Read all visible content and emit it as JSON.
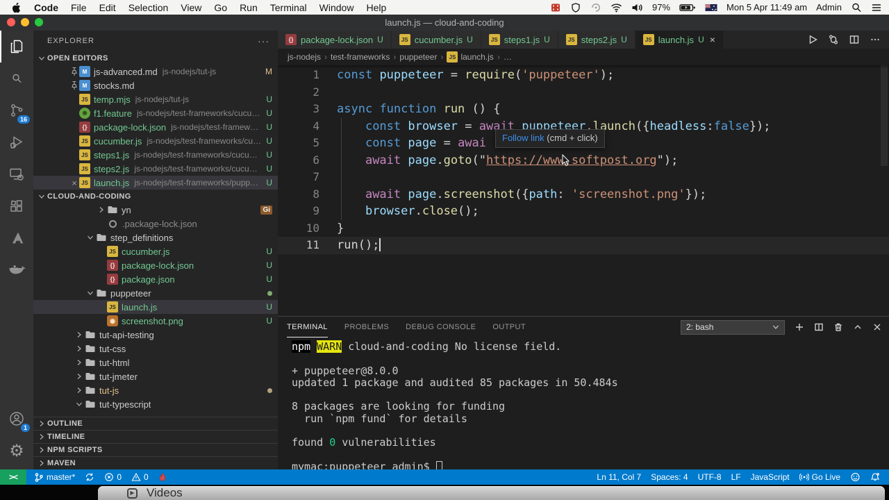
{
  "menubar": {
    "app_menus": [
      "Code",
      "File",
      "Edit",
      "Selection",
      "View",
      "Go",
      "Run",
      "Terminal",
      "Window",
      "Help"
    ],
    "status_items": [
      {
        "icon": "film-icon"
      },
      {
        "icon": "shield-icon"
      },
      {
        "icon": "spiral-icon"
      },
      {
        "icon": "wifi-icon"
      },
      {
        "icon": "volume-icon"
      },
      {
        "text": "97%",
        "name": "battery-percent"
      },
      {
        "icon": "battery-icon"
      },
      {
        "icon": "flag-icon"
      },
      {
        "text": "Mon 5 Apr  11:49 am",
        "name": "clock"
      },
      {
        "text": "Admin",
        "name": "user-menu"
      },
      {
        "icon": "search-icon"
      },
      {
        "icon": "menu-list-icon"
      }
    ]
  },
  "window": {
    "title": "launch.js — cloud-and-coding"
  },
  "activity_bar": {
    "top": [
      {
        "icon": "files-icon",
        "active": true
      },
      {
        "icon": "search-icon",
        "badge": ""
      },
      {
        "icon": "source-control-icon",
        "badge": "16"
      },
      {
        "icon": "debug-icon"
      },
      {
        "icon": "remote-icon"
      },
      {
        "icon": "extensions-icon"
      },
      {
        "icon": "azure-icon"
      },
      {
        "icon": "docker-icon"
      }
    ],
    "bottom": [
      {
        "icon": "account-icon",
        "badge": "1"
      },
      {
        "icon": "settings-icon"
      }
    ]
  },
  "explorer": {
    "title": "EXPLORER",
    "more": "···",
    "open_editors": {
      "label": "OPEN EDITORS",
      "items": [
        {
          "pre": "pin",
          "icon": "md-icon",
          "name": "js-advanced.md",
          "desc": "js-nodejs/tut-js",
          "badge": "M",
          "badge_cls": "c-mod",
          "name_cls": "c-plain"
        },
        {
          "pre": "pin",
          "icon": "md-icon",
          "name": "stocks.md",
          "desc": "",
          "badge": "",
          "name_cls": "c-plain"
        },
        {
          "pre": "",
          "icon": "js-icon",
          "name": "temp.mjs",
          "desc": "js-nodejs/tut-js",
          "badge": "U",
          "badge_cls": "c-u",
          "name_cls": "c-u"
        },
        {
          "pre": "",
          "icon": "feature-icon",
          "name": "f1.feature",
          "desc": "js-nodejs/test-frameworks/cucum...",
          "badge": "U",
          "badge_cls": "c-u",
          "name_cls": "c-u"
        },
        {
          "pre": "",
          "icon": "json-icon",
          "name": "package-lock.json",
          "desc": "js-nodejs/test-framewor...",
          "badge": "U",
          "badge_cls": "c-u",
          "name_cls": "c-u"
        },
        {
          "pre": "",
          "icon": "js-icon",
          "name": "cucumber.js",
          "desc": "js-nodejs/test-frameworks/cuc...",
          "badge": "U",
          "badge_cls": "c-u",
          "name_cls": "c-u"
        },
        {
          "pre": "",
          "icon": "js-icon",
          "name": "steps1.js",
          "desc": "js-nodejs/test-frameworks/cucumb...",
          "badge": "U",
          "badge_cls": "c-u",
          "name_cls": "c-u"
        },
        {
          "pre": "",
          "icon": "js-icon",
          "name": "steps2.js",
          "desc": "js-nodejs/test-frameworks/cucumb...",
          "badge": "U",
          "badge_cls": "c-u",
          "name_cls": "c-u"
        },
        {
          "pre": "close",
          "icon": "js-icon",
          "name": "launch.js",
          "desc": "js-nodejs/test-frameworks/puppete...",
          "badge": "U",
          "badge_cls": "c-u",
          "name_cls": "c-u",
          "selected": true
        }
      ]
    },
    "workspace": {
      "label": "CLOUD-AND-CODING",
      "items": [
        {
          "depth": 3,
          "arrow": "right",
          "icon": "folder-icon",
          "name": "yn",
          "name_cls": "c-plain",
          "gi": "Gi"
        },
        {
          "depth": 3,
          "arrow": "",
          "icon": "circle-icon",
          "name": ".package-lock.json",
          "name_cls": "c-ign"
        },
        {
          "depth": 2,
          "arrow": "down",
          "icon": "folder-icon",
          "name": "step_definitions",
          "name_cls": "c-plain"
        },
        {
          "depth": 3,
          "arrow": "",
          "icon": "js-icon",
          "name": "cucumber.js",
          "name_cls": "c-u",
          "badge": "U",
          "badge_cls": "c-u"
        },
        {
          "depth": 3,
          "arrow": "",
          "icon": "json-icon",
          "name": "package-lock.json",
          "name_cls": "c-u",
          "badge": "U",
          "badge_cls": "c-u"
        },
        {
          "depth": 3,
          "arrow": "",
          "icon": "json-icon",
          "name": "package.json",
          "name_cls": "c-u",
          "badge": "U",
          "badge_cls": "c-u"
        },
        {
          "depth": 2,
          "arrow": "down",
          "icon": "folder-icon",
          "name": "puppeteer",
          "name_cls": "c-plain",
          "dot": "#7fae6f"
        },
        {
          "depth": 3,
          "arrow": "",
          "icon": "js-icon",
          "name": "launch.js",
          "name_cls": "c-u",
          "badge": "U",
          "badge_cls": "c-u",
          "selected": true
        },
        {
          "depth": 3,
          "arrow": "",
          "icon": "png-icon",
          "name": "screenshot.png",
          "name_cls": "c-u",
          "badge": "U",
          "badge_cls": "c-u"
        },
        {
          "depth": 1,
          "arrow": "right",
          "icon": "folder-icon",
          "name": "tut-api-testing",
          "name_cls": "c-plain"
        },
        {
          "depth": 1,
          "arrow": "right",
          "icon": "folder-icon",
          "name": "tut-css",
          "name_cls": "c-plain"
        },
        {
          "depth": 1,
          "arrow": "right",
          "icon": "folder-icon",
          "name": "tut-html",
          "name_cls": "c-plain"
        },
        {
          "depth": 1,
          "arrow": "right",
          "icon": "folder-icon",
          "name": "tut-jmeter",
          "name_cls": "c-plain"
        },
        {
          "depth": 1,
          "arrow": "right",
          "icon": "folder-icon",
          "name": "tut-js",
          "name_cls": "c-mod",
          "dot": "#b3a27e"
        },
        {
          "depth": 1,
          "arrow": "down",
          "icon": "folder-icon",
          "name": "tut-typescript",
          "name_cls": "c-plain"
        }
      ]
    },
    "bottom_sections": [
      "OUTLINE",
      "TIMELINE",
      "NPM SCRIPTS",
      "MAVEN"
    ]
  },
  "tabs": [
    {
      "icon": "json-icon",
      "label": "package-lock.json",
      "badge": "U"
    },
    {
      "icon": "js-icon",
      "label": "cucumber.js",
      "badge": "U"
    },
    {
      "icon": "js-icon",
      "label": "steps1.js",
      "badge": "U"
    },
    {
      "icon": "js-icon",
      "label": "steps2.js",
      "badge": "U"
    },
    {
      "icon": "js-icon",
      "label": "launch.js",
      "badge": "U",
      "active": true,
      "close": "×"
    }
  ],
  "tab_actions": [
    {
      "icon": "run-icon"
    },
    {
      "icon": "compare-icon"
    },
    {
      "icon": "split-editor-icon"
    },
    {
      "icon": "more-icon"
    }
  ],
  "breadcrumb": [
    {
      "label": "js-nodejs"
    },
    {
      "label": "test-frameworks"
    },
    {
      "label": "puppeteer"
    },
    {
      "label": "launch.js",
      "icon": "js-icon"
    },
    {
      "label": "…"
    }
  ],
  "editor": {
    "lines": [
      {
        "num": "1",
        "tokens": [
          [
            "k",
            "const"
          ],
          [
            "p",
            " "
          ],
          [
            "v",
            "puppeteer"
          ],
          [
            "p",
            " = "
          ],
          [
            "f",
            "require"
          ],
          [
            "p",
            "("
          ],
          [
            "s",
            "'puppeteer'"
          ],
          [
            "p",
            ");"
          ]
        ]
      },
      {
        "num": "2",
        "tokens": []
      },
      {
        "num": "3",
        "tokens": [
          [
            "k",
            "async"
          ],
          [
            "p",
            " "
          ],
          [
            "k",
            "function"
          ],
          [
            "p",
            " "
          ],
          [
            "f",
            "run"
          ],
          [
            "p",
            " () {"
          ]
        ]
      },
      {
        "num": "4",
        "tokens": [
          [
            "p",
            "    "
          ],
          [
            "k",
            "const"
          ],
          [
            "p",
            " "
          ],
          [
            "v",
            "browser"
          ],
          [
            "p",
            " = "
          ],
          [
            "a",
            "await"
          ],
          [
            "p",
            " "
          ],
          [
            "v",
            "puppeteer"
          ],
          [
            "p",
            "."
          ],
          [
            "f",
            "launch"
          ],
          [
            "p",
            "({"
          ],
          [
            "v",
            "headless"
          ],
          [
            "p",
            ":"
          ],
          [
            "k",
            "false"
          ],
          [
            "p",
            "});"
          ]
        ]
      },
      {
        "num": "5",
        "tokens": [
          [
            "p",
            "    "
          ],
          [
            "k",
            "const"
          ],
          [
            "p",
            " "
          ],
          [
            "v",
            "page"
          ],
          [
            "p",
            " = "
          ],
          [
            "a",
            "awai"
          ]
        ]
      },
      {
        "num": "6",
        "tokens": [
          [
            "p",
            "    "
          ],
          [
            "a",
            "await"
          ],
          [
            "p",
            " "
          ],
          [
            "v",
            "page"
          ],
          [
            "p",
            "."
          ],
          [
            "f",
            "goto"
          ],
          [
            "p",
            "(\""
          ],
          [
            "u",
            "https://www.softpost.org"
          ],
          [
            "p",
            "\");"
          ]
        ]
      },
      {
        "num": "7",
        "tokens": []
      },
      {
        "num": "8",
        "tokens": [
          [
            "p",
            "    "
          ],
          [
            "a",
            "await"
          ],
          [
            "p",
            " "
          ],
          [
            "v",
            "page"
          ],
          [
            "p",
            "."
          ],
          [
            "f",
            "screenshot"
          ],
          [
            "p",
            "({"
          ],
          [
            "v",
            "path"
          ],
          [
            "p",
            ": "
          ],
          [
            "s",
            "'screenshot.png'"
          ],
          [
            "p",
            "});"
          ]
        ]
      },
      {
        "num": "9",
        "tokens": [
          [
            "p",
            "    "
          ],
          [
            "v",
            "browser"
          ],
          [
            "p",
            "."
          ],
          [
            "f",
            "close"
          ],
          [
            "p",
            "();"
          ]
        ]
      },
      {
        "num": "10",
        "tokens": [
          [
            "p",
            "}"
          ]
        ]
      },
      {
        "num": "11",
        "tokens": [
          [
            "p",
            "run();"
          ]
        ],
        "current": true,
        "caret": true
      }
    ],
    "tooltip": {
      "link": "Follow link",
      "rest": " (cmd + click)"
    }
  },
  "terminal": {
    "tabs": [
      {
        "label": "TERMINAL",
        "active": true
      },
      {
        "label": "PROBLEMS"
      },
      {
        "label": "DEBUG CONSOLE"
      },
      {
        "label": "OUTPUT"
      }
    ],
    "shell_select": "2: bash",
    "actions": [
      "plus-icon",
      "split-icon",
      "trash-icon",
      "chevron-up-icon",
      "close-icon"
    ],
    "lines": [
      [
        [
          "inv",
          "npm"
        ],
        [
          "p",
          " "
        ],
        [
          "warn",
          "WARN"
        ],
        [
          "p",
          " cloud-and-coding No license field."
        ]
      ],
      [],
      [
        [
          "p",
          "+ puppeteer@8.0.0"
        ]
      ],
      [
        [
          "p",
          "updated 1 package and audited 85 packages in 50.484s"
        ]
      ],
      [],
      [
        [
          "p",
          "8 packages are looking for funding"
        ]
      ],
      [
        [
          "p",
          "  run `npm fund` for details"
        ]
      ],
      [],
      [
        [
          "p",
          "found "
        ],
        [
          "g",
          "0"
        ],
        [
          "p",
          " vulnerabilities"
        ]
      ],
      [],
      [
        [
          "p",
          "mymac:puppeteer admin$ "
        ],
        [
          "cur",
          ""
        ]
      ]
    ]
  },
  "status_bar": {
    "remote": "><",
    "left": [
      {
        "icon": "branch-icon",
        "text": "master*",
        "name": "git-branch"
      },
      {
        "icon": "sync-icon",
        "name": "sync"
      },
      {
        "icon": "error-icon",
        "text": "0",
        "name": "errors"
      },
      {
        "icon": "warning-icon",
        "text": "0",
        "name": "warnings"
      },
      {
        "icon": "flame-icon",
        "name": "flame"
      }
    ],
    "right": [
      {
        "text": "Ln 11, Col 7",
        "name": "cursor-position"
      },
      {
        "text": "Spaces: 4",
        "name": "indentation"
      },
      {
        "text": "UTF-8",
        "name": "encoding"
      },
      {
        "text": "LF",
        "name": "eol"
      },
      {
        "text": "JavaScript",
        "name": "language-mode"
      },
      {
        "icon": "broadcast-icon",
        "text": "Go Live",
        "name": "go-live"
      },
      {
        "icon": "feedback-icon",
        "name": "feedback"
      },
      {
        "icon": "bell-icon",
        "name": "notifications"
      }
    ]
  },
  "desktop": {
    "videos_label": "Videos"
  },
  "colors": {
    "accent": "#007acc",
    "remote_green": "#17a05e",
    "untracked_green": "#73c991",
    "modified_yellow": "#e2c08d",
    "editor_bg": "#1e1e1e",
    "sidebar_bg": "#252526"
  }
}
